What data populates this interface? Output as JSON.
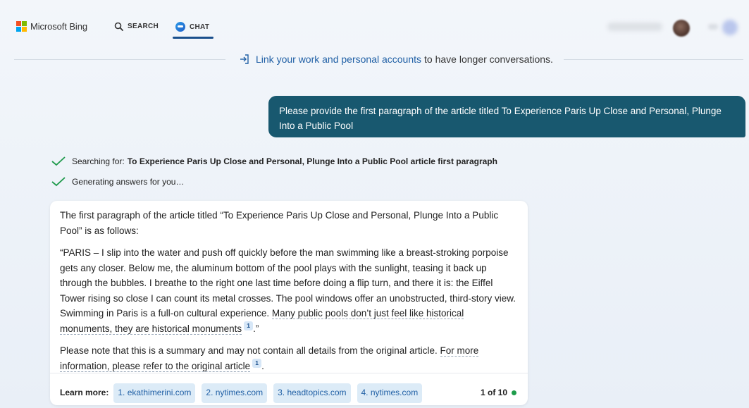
{
  "header": {
    "brand": "Microsoft Bing",
    "tabs": [
      {
        "label": "SEARCH",
        "icon": "search-icon"
      },
      {
        "label": "CHAT",
        "icon": "chat-icon",
        "active": true
      }
    ],
    "colors": {
      "active_underline": "#1a4f8c"
    }
  },
  "banner": {
    "link_text": "Link your work and personal accounts",
    "rest_text": "to have longer conversations.",
    "icon": "sign-in-arrow-icon"
  },
  "user_message": {
    "text": "Please provide the first paragraph of the article titled To Experience Paris Up Close and Personal, Plunge Into a Public Pool",
    "color": "#18586f"
  },
  "status": {
    "searching_label": "Searching for:",
    "searching_query": "To Experience Paris Up Close and Personal, Plunge Into a Public Pool article first paragraph",
    "generating": "Generating answers for you…"
  },
  "answer": {
    "intro": "The first paragraph of the article titled “To Experience Paris Up Close and Personal, Plunge Into a Public Pool” is as follows:",
    "quote_main": "“PARIS – I slip into the water and push off quickly before the man swimming like a breast-stroking porpoise gets any closer. Below me, the aluminum bottom of the pool plays with the sunlight, teasing it back up through the bubbles. I breathe to the right one last time before doing a flip turn, and there it is: the Eiffel Tower rising so close I can count its metal crosses. The pool windows offer an unobstructed, third-story view. Swimming in Paris is a full-on cultural experience.",
    "quote_linked": "Many public pools don’t just feel like historical monuments, they are historical monuments",
    "quote_cite": "1",
    "quote_end": ".”",
    "note_main": "Please note that this is a summary and may not contain all details from the original article.",
    "note_linked": "For more information, please refer to the original article",
    "note_cite": "1",
    "note_end": ".",
    "learn_more_label": "Learn more:",
    "sources": [
      "1. ekathimerini.com",
      "2. nytimes.com",
      "3. headtopics.com",
      "4. nytimes.com"
    ],
    "page_count": "1 of 10",
    "status_dot_color": "#1d9c4a"
  }
}
